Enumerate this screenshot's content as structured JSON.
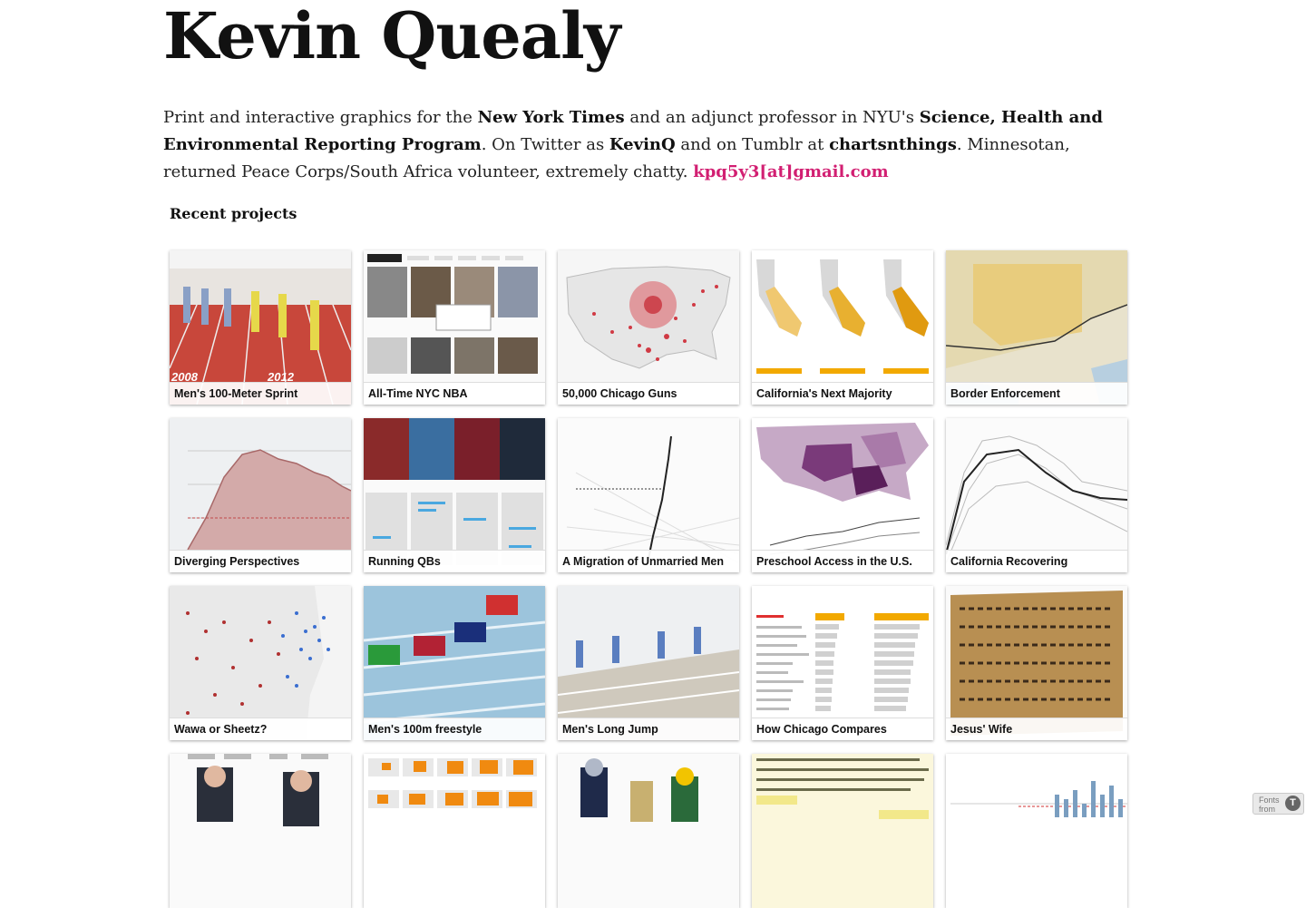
{
  "page_title": "Kevin Quealy",
  "bio": {
    "t1": "Print and interactive graphics for the ",
    "b1": "New York Times",
    "t2": " and an adjunct professor in NYU's ",
    "b2": "Science, Health and Environmental Reporting Program",
    "t3": ". On Twitter as ",
    "b3": "KevinQ",
    "t4": " and on Tumblr at ",
    "b4": "chartsnthings",
    "t5": ". Minnesotan, returned Peace Corps/South Africa volunteer, extremely chatty. ",
    "email": "kpq5y3[at]gmail.com"
  },
  "section_heading": "Recent projects",
  "projects": [
    {
      "title": "Men's 100-Meter Sprint"
    },
    {
      "title": "All-Time NYC NBA"
    },
    {
      "title": "50,000 Chicago Guns"
    },
    {
      "title": "California's Next Majority"
    },
    {
      "title": "Border Enforcement"
    },
    {
      "title": "Diverging Perspectives"
    },
    {
      "title": "Running QBs"
    },
    {
      "title": "A Migration of Unmarried Men"
    },
    {
      "title": "Preschool Access in the U.S."
    },
    {
      "title": "California Recovering"
    },
    {
      "title": "Wawa or Sheetz?"
    },
    {
      "title": "Men's 100m freestyle"
    },
    {
      "title": "Men's Long Jump"
    },
    {
      "title": "How Chicago Compares"
    },
    {
      "title": "Jesus' Wife"
    },
    {
      "title": ""
    },
    {
      "title": ""
    },
    {
      "title": ""
    },
    {
      "title": ""
    },
    {
      "title": ""
    }
  ],
  "fonts_badge": {
    "line1": "Fonts",
    "line2": "from"
  },
  "colors": {
    "accent": "#d21f72"
  }
}
